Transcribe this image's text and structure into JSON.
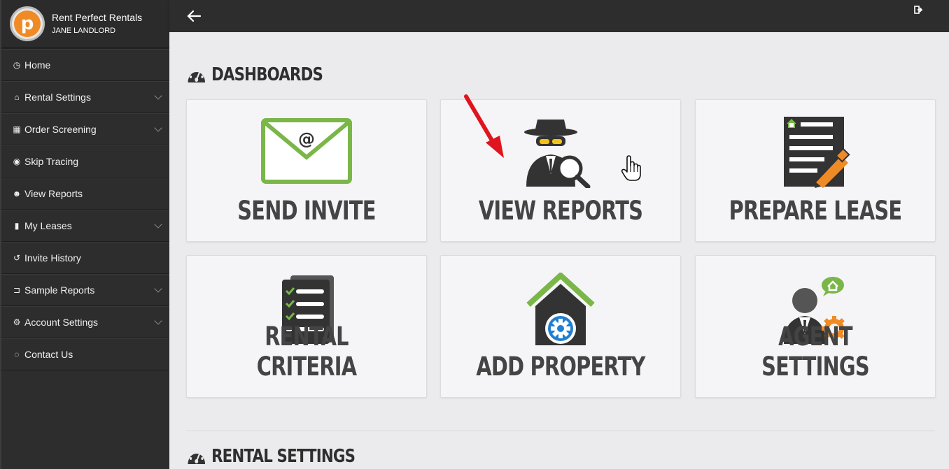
{
  "brand": {
    "name": "Rent Perfect Rentals",
    "user": "JANE LANDLORD"
  },
  "menu": [
    {
      "label": "Home",
      "icon": "dashboard-icon",
      "glyph": "◷",
      "submenu": false
    },
    {
      "label": "Rental Settings",
      "icon": "home-icon",
      "glyph": "⌂",
      "submenu": true
    },
    {
      "label": "Order Screening",
      "icon": "calendar-icon",
      "glyph": "▦",
      "submenu": true
    },
    {
      "label": "Skip Tracing",
      "icon": "eye-icon",
      "glyph": "◉",
      "submenu": false
    },
    {
      "label": "View Reports",
      "icon": "users-icon",
      "glyph": "☻",
      "submenu": false
    },
    {
      "label": "My Leases",
      "icon": "file-icon",
      "glyph": "▮",
      "submenu": true
    },
    {
      "label": "Invite History",
      "icon": "history-icon",
      "glyph": "↺",
      "submenu": false
    },
    {
      "label": "Sample Reports",
      "icon": "folder-open-icon",
      "glyph": "⊐",
      "submenu": true
    },
    {
      "label": "Account Settings",
      "icon": "cogs-icon",
      "glyph": "⚙",
      "submenu": true
    },
    {
      "label": "Contact Us",
      "icon": "comments-icon",
      "glyph": "◌",
      "submenu": false
    }
  ],
  "topbar": {
    "back_icon": "arrow-left-icon",
    "logout_icon": "sign-out-icon"
  },
  "sections": {
    "dashboards": "DASHBOARDS",
    "rental_settings": "RENTAL SETTINGS"
  },
  "tiles": [
    {
      "label": "SEND INVITE",
      "icon": "envelope-icon"
    },
    {
      "label": "VIEW REPORTS",
      "icon": "spy-magnifier-icon"
    },
    {
      "label": "PREPARE LEASE",
      "icon": "lease-document-icon"
    },
    {
      "label": "RENTAL CRITERIA",
      "icon": "checklist-icon"
    },
    {
      "label": "ADD PROPERTY",
      "icon": "house-gear-icon"
    },
    {
      "label": "AGENT SETTINGS",
      "icon": "agent-icon"
    }
  ],
  "colors": {
    "sidebar": "#2d2d2d",
    "accent_green": "#7ab648",
    "accent_orange": "#f08a24",
    "arrow_red": "#e0141e"
  }
}
